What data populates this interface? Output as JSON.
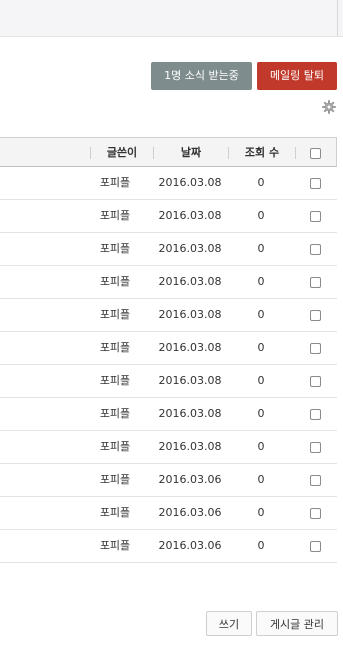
{
  "header": {
    "subscribe_label": "1명 소식 받는중",
    "unsubscribe_label": "메일링 탈퇴"
  },
  "colors": {
    "subscribe_bg": "#7f8c8d",
    "unsubscribe_bg": "#c0392b"
  },
  "icons": {
    "settings": "gear-icon"
  },
  "table": {
    "columns": {
      "author": "글쓴이",
      "date": "날짜",
      "views": "조회 수"
    },
    "rows": [
      {
        "author": "포피플",
        "date": "2016.03.08",
        "views": "0"
      },
      {
        "author": "포피플",
        "date": "2016.03.08",
        "views": "0"
      },
      {
        "author": "포피플",
        "date": "2016.03.08",
        "views": "0"
      },
      {
        "author": "포피플",
        "date": "2016.03.08",
        "views": "0"
      },
      {
        "author": "포피플",
        "date": "2016.03.08",
        "views": "0"
      },
      {
        "author": "포피플",
        "date": "2016.03.08",
        "views": "0"
      },
      {
        "author": "포피플",
        "date": "2016.03.08",
        "views": "0"
      },
      {
        "author": "포피플",
        "date": "2016.03.08",
        "views": "0"
      },
      {
        "author": "포피플",
        "date": "2016.03.08",
        "views": "0"
      },
      {
        "author": "포피플",
        "date": "2016.03.06",
        "views": "0"
      },
      {
        "author": "포피플",
        "date": "2016.03.06",
        "views": "0"
      },
      {
        "author": "포피플",
        "date": "2016.03.06",
        "views": "0"
      }
    ]
  },
  "footer": {
    "write_label": "쓰기",
    "manage_label": "게시글 관리"
  }
}
